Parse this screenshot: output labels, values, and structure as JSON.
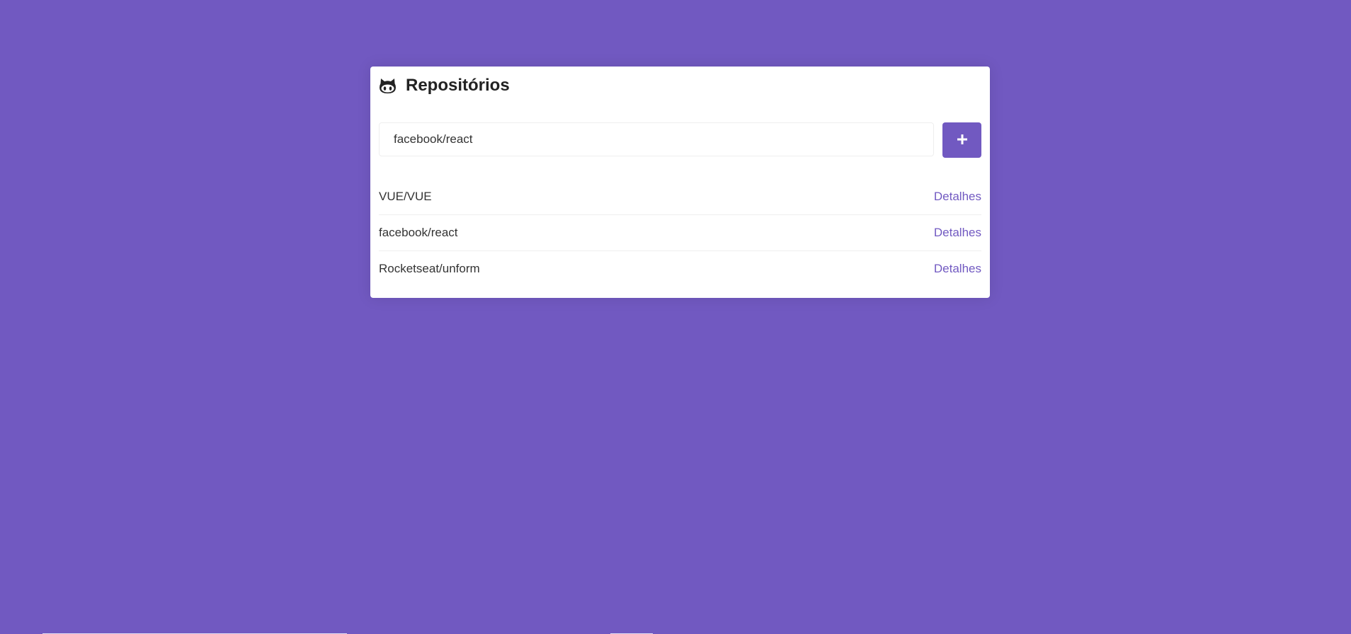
{
  "page": {
    "background_color": "#7159c1",
    "title": "Repositórios",
    "title_icon": "github-icon"
  },
  "form": {
    "input_value": "facebook/react",
    "add_button_icon": "plus-icon"
  },
  "repositories": [
    {
      "name": "VUE/VUE",
      "link_label": "Detalhes"
    },
    {
      "name": "facebook/react",
      "link_label": "Detalhes"
    },
    {
      "name": "Rocketseat/unform",
      "link_label": "Detalhes"
    }
  ],
  "colors": {
    "accent": "#7159c1",
    "text": "#333333",
    "card": "#ffffff"
  }
}
